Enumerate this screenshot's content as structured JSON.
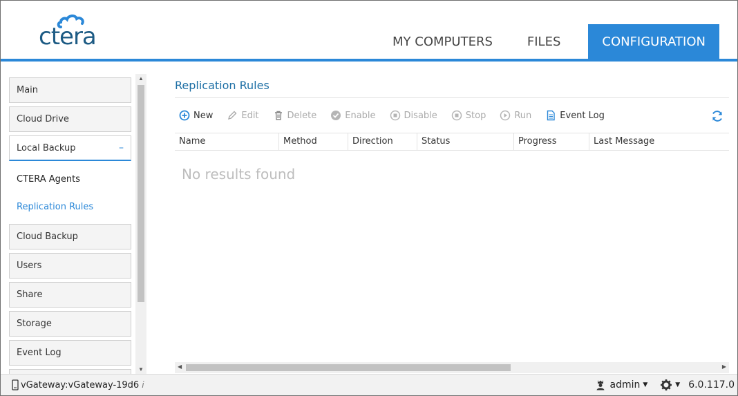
{
  "app": {
    "logo_text": "ctera"
  },
  "nav": {
    "tabs": [
      {
        "label": "MY COMPUTERS"
      },
      {
        "label": "FILES"
      },
      {
        "label": "CONFIGURATION"
      }
    ]
  },
  "sidebar": {
    "items": [
      {
        "label": "Main"
      },
      {
        "label": "Cloud Drive"
      },
      {
        "label": "Local Backup",
        "toggle": "–"
      },
      {
        "label": "Cloud Backup"
      },
      {
        "label": "Users"
      },
      {
        "label": "Share"
      },
      {
        "label": "Storage"
      },
      {
        "label": "Event Log"
      }
    ],
    "subitems": [
      {
        "label": "CTERA Agents"
      },
      {
        "label": "Replication Rules"
      }
    ]
  },
  "main": {
    "title": "Replication Rules",
    "toolbar": {
      "new": "New",
      "edit": "Edit",
      "delete": "Delete",
      "enable": "Enable",
      "disable": "Disable",
      "stop": "Stop",
      "run": "Run",
      "event_log": "Event Log"
    },
    "columns": [
      "Name",
      "Method",
      "Direction",
      "Status",
      "Progress",
      "Last Message"
    ],
    "empty_text": "No results found"
  },
  "footer": {
    "device": "vGateway:vGateway-19d6",
    "user": "admin",
    "version": "6.0.117.0"
  },
  "colors": {
    "accent": "#2b88d8",
    "brand": "#1d5b84"
  }
}
